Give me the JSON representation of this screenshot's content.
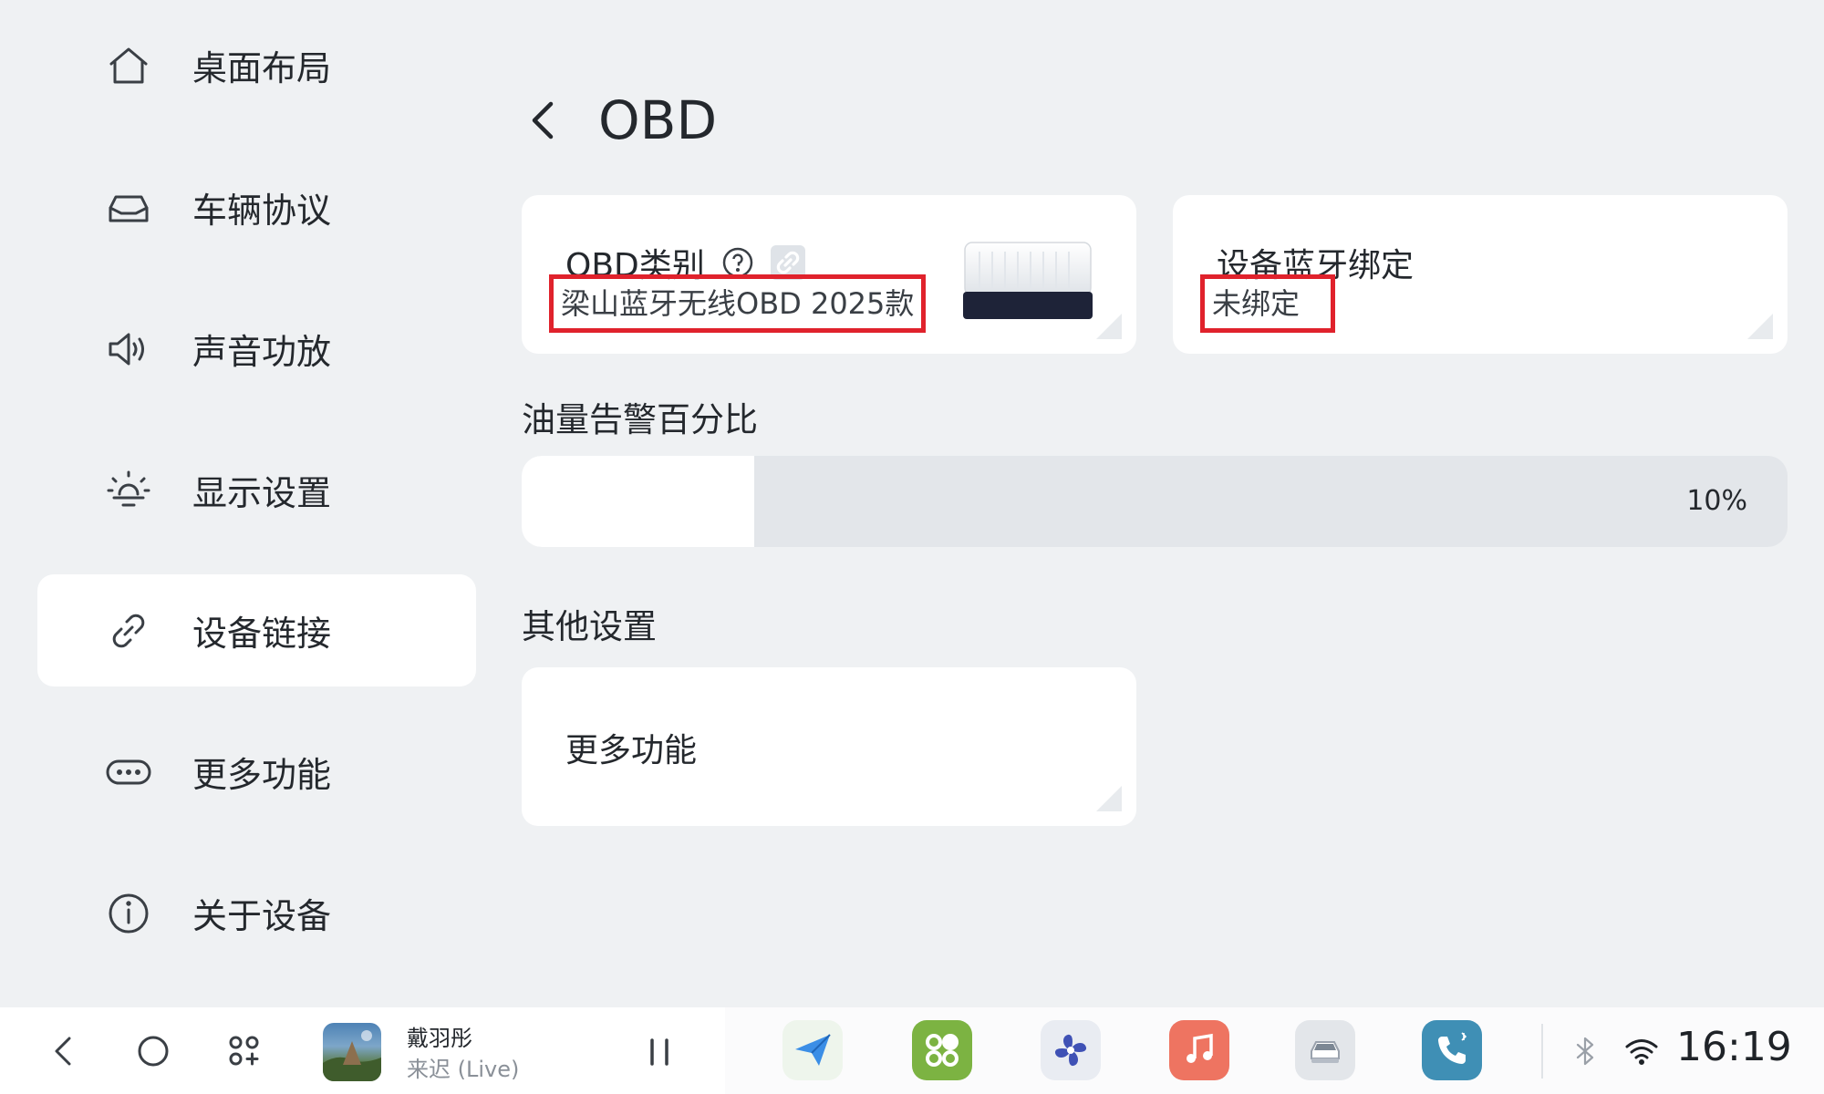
{
  "sidebar": {
    "items": [
      {
        "label": "桌面布局",
        "icon": "home-icon"
      },
      {
        "label": "车辆协议",
        "icon": "car-icon"
      },
      {
        "label": "声音功放",
        "icon": "speaker-icon"
      },
      {
        "label": "显示设置",
        "icon": "brightness-icon"
      },
      {
        "label": "设备链接",
        "icon": "link-icon",
        "active": true
      },
      {
        "label": "更多功能",
        "icon": "more-dots-icon"
      },
      {
        "label": "关于设备",
        "icon": "info-icon"
      }
    ]
  },
  "header": {
    "title": "OBD"
  },
  "obd_card": {
    "title": "OBD类别",
    "value": "梁山蓝牙无线OBD 2025款"
  },
  "bluetooth_card": {
    "title": "设备蓝牙绑定",
    "value": "未绑定"
  },
  "fuel_warning": {
    "label": "油量告警百分比",
    "value_text": "10%",
    "fill_fraction": 0.1
  },
  "other_settings": {
    "label": "其他设置",
    "more_label": "更多功能"
  },
  "bottom_bar": {
    "song_title": "戴羽彤",
    "song_artist": "来迟 (Live)",
    "apps": [
      "navigation-app-icon",
      "apps-grid-app-icon",
      "fan-app-icon",
      "music-app-icon",
      "car-app-icon",
      "phone-app-icon"
    ],
    "colors": {
      "navigation": "#e9f3e8",
      "apps": "#7cb342",
      "fan": "#e6e9ef",
      "music": "#ee7461",
      "car": "#e3e6ea",
      "phone": "#3f8fb5"
    },
    "clock": "16:19"
  }
}
